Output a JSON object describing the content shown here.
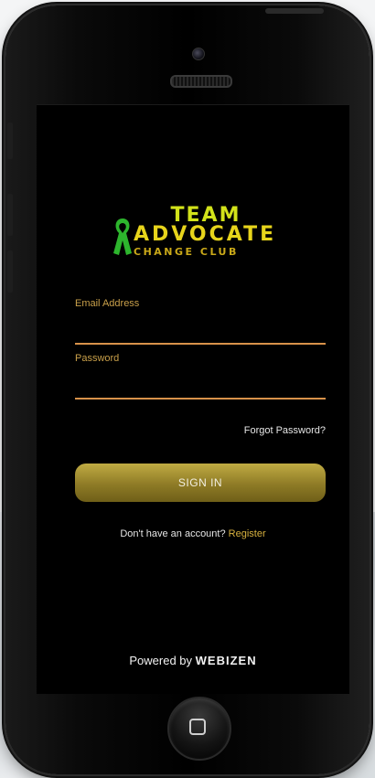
{
  "logo": {
    "line1": "TEAM",
    "line2": "ADVOCATE",
    "line3": "CHANGE CLUB"
  },
  "form": {
    "email_label": "Email Address",
    "email_value": "",
    "password_label": "Password",
    "password_value": "",
    "forgot_label": "Forgot Password?",
    "signin_label": "SIGN IN"
  },
  "footer": {
    "no_account_text": "Don't have an account?",
    "register_label": "Register",
    "powered_prefix": "Powered by",
    "powered_brand": "WEBIZEN"
  },
  "colors": {
    "accent_gold": "#c0ab43",
    "input_underline": "#d8924a",
    "label_gold": "#c9a04a",
    "logo_green": "#2db52d",
    "screen_bg": "#000000"
  },
  "icons": [
    "camera-icon",
    "speaker-grille",
    "ribbon-icon",
    "home-button-square-icon"
  ]
}
